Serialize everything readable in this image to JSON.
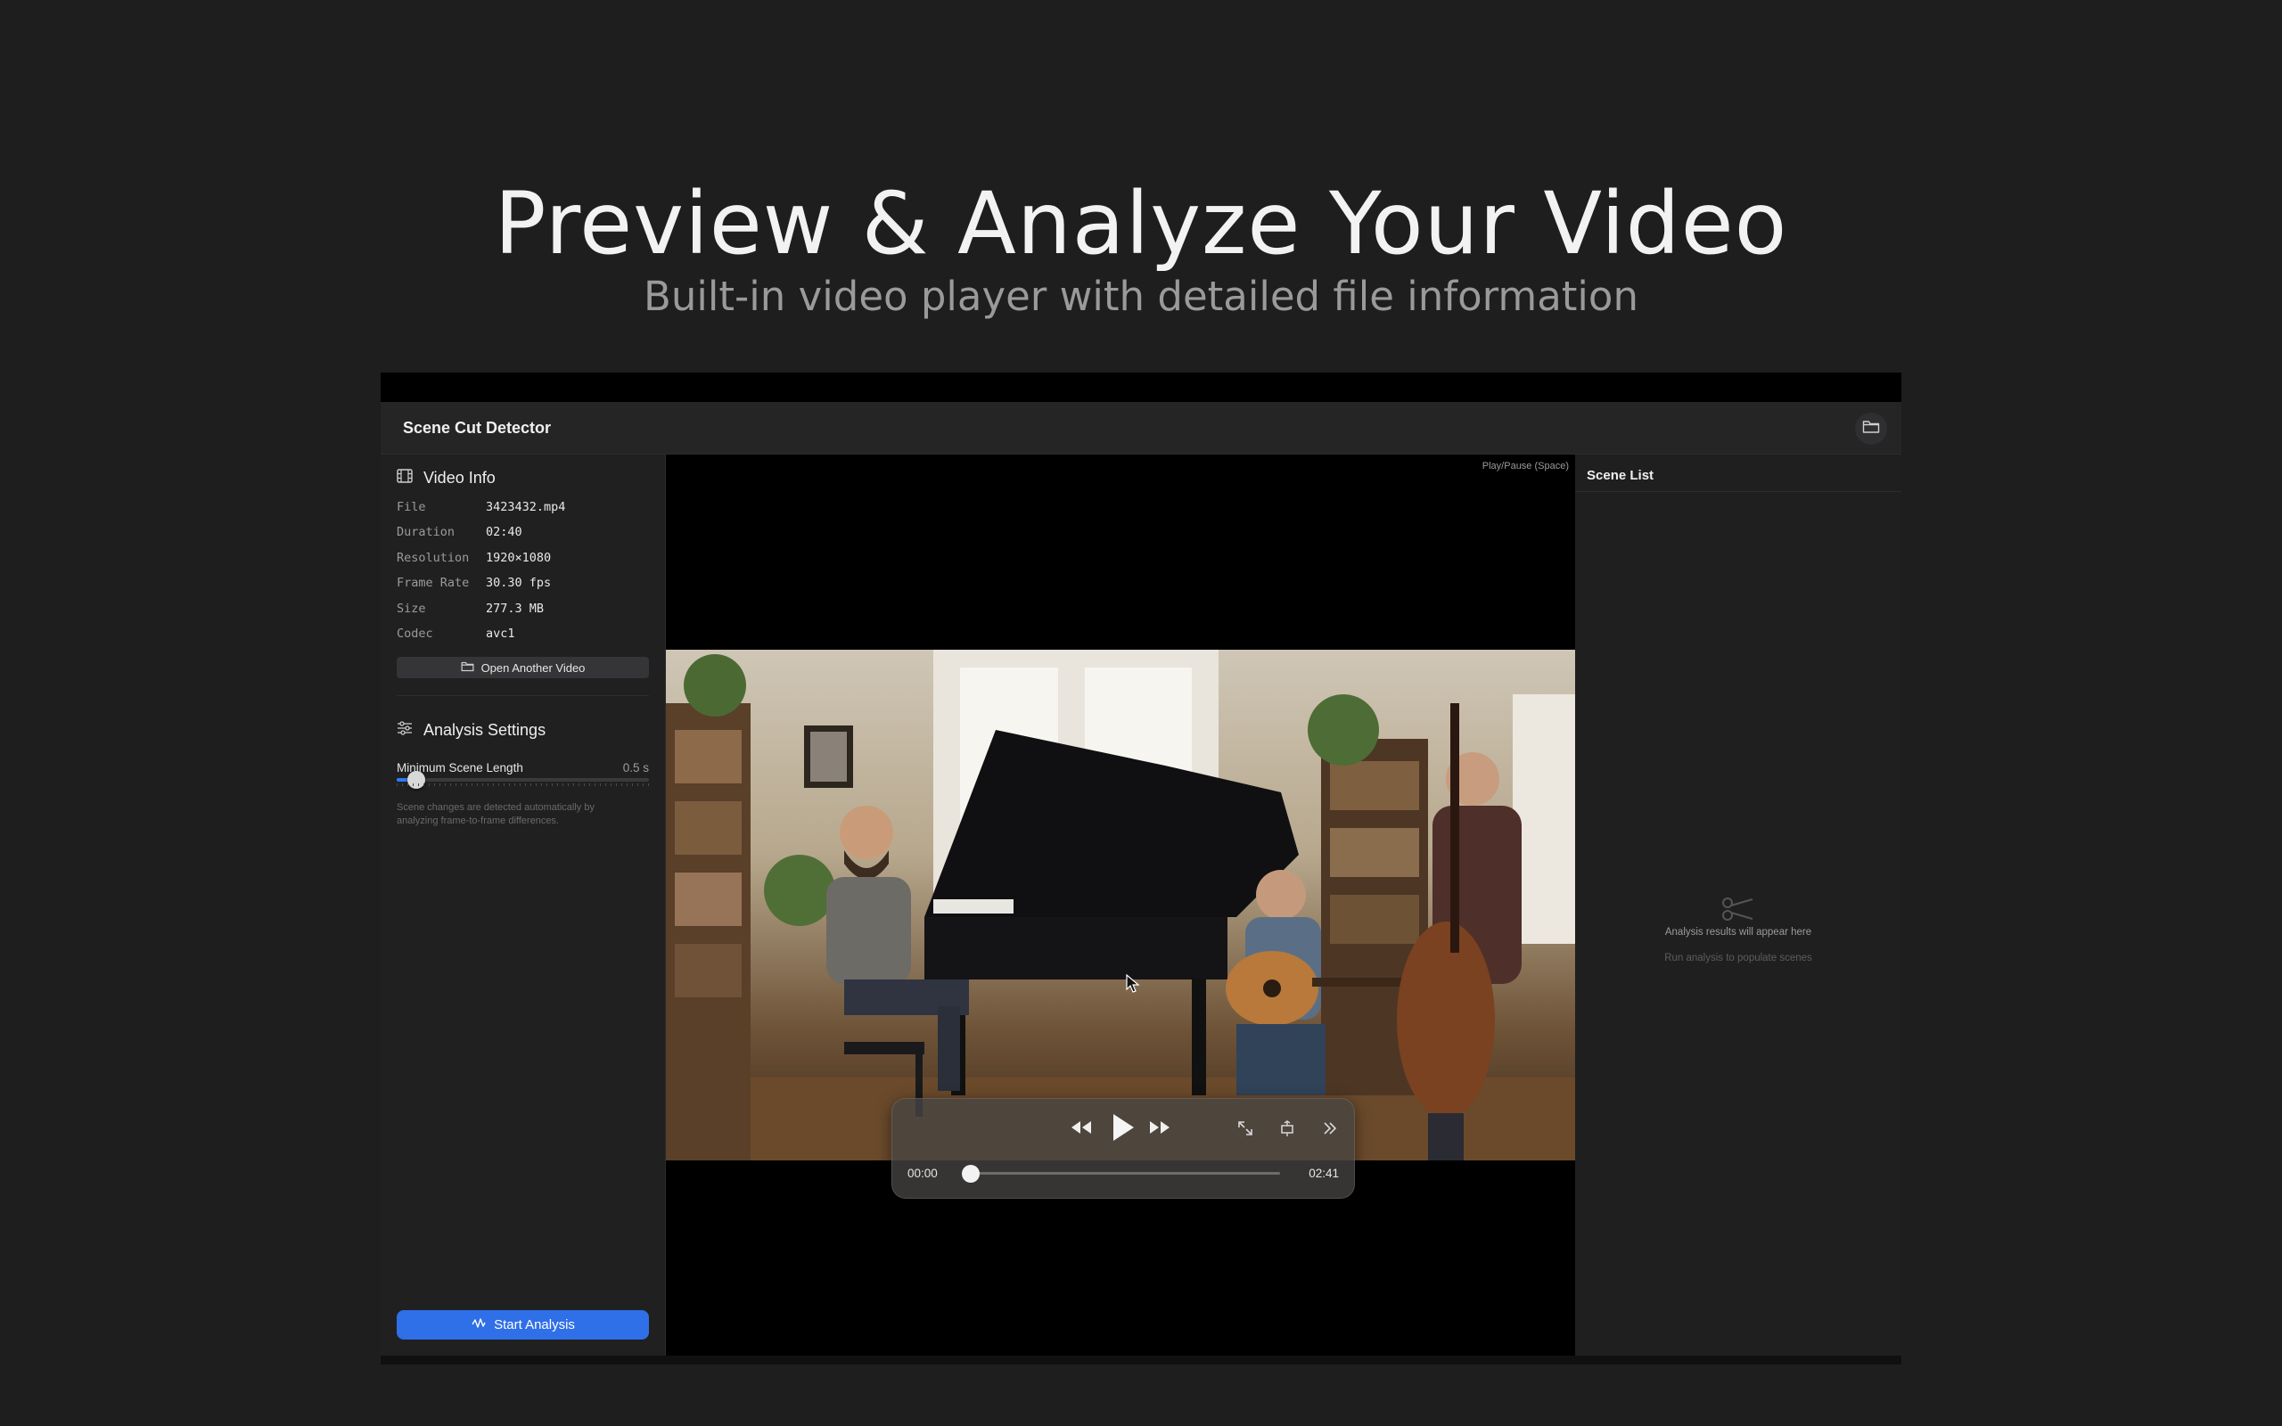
{
  "hero": {
    "title": "Preview & Analyze Your Video",
    "subtitle": "Built-in video player with detailed file information"
  },
  "app": {
    "title": "Scene Cut Detector",
    "open_folder_icon": "folder-icon"
  },
  "video_info": {
    "heading": "Video Info",
    "icon": "film-icon",
    "rows": [
      {
        "key": "File",
        "value": "3423432.mp4"
      },
      {
        "key": "Duration",
        "value": "02:40"
      },
      {
        "key": "Resolution",
        "value": "1920×1080"
      },
      {
        "key": "Frame Rate",
        "value": "30.30 fps"
      },
      {
        "key": "Size",
        "value": "277.3 MB"
      },
      {
        "key": "Codec",
        "value": "avc1"
      }
    ],
    "open_another_label": "Open Another Video"
  },
  "analysis_settings": {
    "heading": "Analysis Settings",
    "icon": "sliders-icon",
    "min_scene_label": "Minimum Scene Length",
    "min_scene_value": "0.5 s",
    "slider_fraction": 0.077,
    "help_text": "Scene changes are detected automatically by analyzing frame-to-frame differences.",
    "start_label": "Start Analysis",
    "accent_color": "#2f6fe8"
  },
  "player": {
    "hint": "Play/Pause (Space)",
    "current_time": "00:00",
    "total_time": "02:41",
    "progress_fraction": 0.0
  },
  "scene_list": {
    "title": "Scene List",
    "empty_icon": "scissors-icon",
    "empty_title": "Analysis results will appear here",
    "empty_subtitle": "Run analysis to populate scenes"
  }
}
